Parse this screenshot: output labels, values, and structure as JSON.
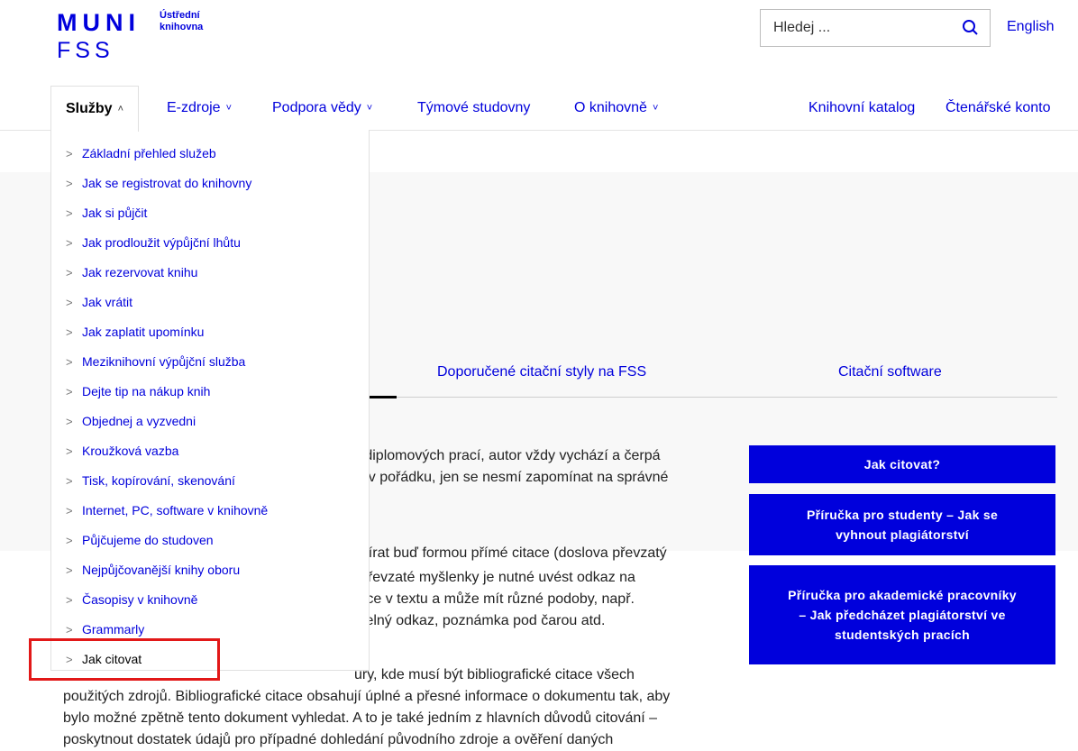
{
  "header": {
    "logo_muni": "MUNI",
    "logo_fss": "FSS",
    "logo_line1": "Ústřední",
    "logo_line2": "knihovna",
    "search_placeholder": "Hledej ...",
    "lang_link": "English"
  },
  "nav": {
    "items": [
      {
        "label": "Služby",
        "chev": "^"
      },
      {
        "label": "E-zdroje",
        "chev": "v"
      },
      {
        "label": "Podpora vědy",
        "chev": "v"
      },
      {
        "label": "Týmové studovny"
      },
      {
        "label": "O knihovně",
        "chev": "v"
      }
    ],
    "right": [
      "Knihovní katalog",
      "Čtenářské konto"
    ]
  },
  "dropdown": {
    "items": [
      "Základní přehled služeb",
      "Jak se registrovat do knihovny",
      "Jak si půjčit",
      "Jak prodloužit výpůjční lhůtu",
      "Jak rezervovat knihu",
      "Jak vrátit",
      "Jak zaplatit upomínku",
      "Meziknihovní výpůjční služba",
      "Dejte tip na nákup knih",
      "Objednej a vyzvedni",
      "Kroužková vazba",
      "Tisk, kopírování, skenování",
      "Internet, PC, software v knihovně",
      "Půjčujeme do studoven",
      "Nejpůjčovanější knihy oboru",
      "Časopisy v knihovně",
      "Grammarly",
      "Jak citovat"
    ],
    "arrow": ">"
  },
  "tabs": [
    "Doporučené citační styly na FSS",
    "Citační software"
  ],
  "content": {
    "p1": [
      "a diplomových prací, autor vždy vychází a čerpá",
      "to v pořádku, jen se nesmí zapomínat na správné"
    ],
    "p2": [
      "ebírat buď formou přímé citace (doslova převzatý",
      "převzaté myšlenky je nutné uvést odkaz na",
      "tace v textu a může mít různé podoby, např.",
      "íselný odkaz, poznámka pod čarou atd."
    ],
    "p3": [
      "ury, kde musí být bibliografické citace všech",
      "použitých zdrojů. Bibliografické citace obsahují úplné a přesné informace o dokumentu tak, aby",
      "bylo možné zpětně tento dokument vyhledat. A to je také jedním z hlavních důvodů citování –",
      "poskytnout dostatek údajů pro případné dohledání původního zdroje a ověření daných"
    ]
  },
  "sidebar_buttons": [
    "Jak citovat?",
    "Příručka pro studenty – Jak se vyhnout plagiátorství",
    "Příručka pro akademické pracovníky – Jak předcházet plagiátorství ve studentských pracích"
  ],
  "colors": {
    "accent": "#0000dc",
    "highlight": "#e21818"
  }
}
